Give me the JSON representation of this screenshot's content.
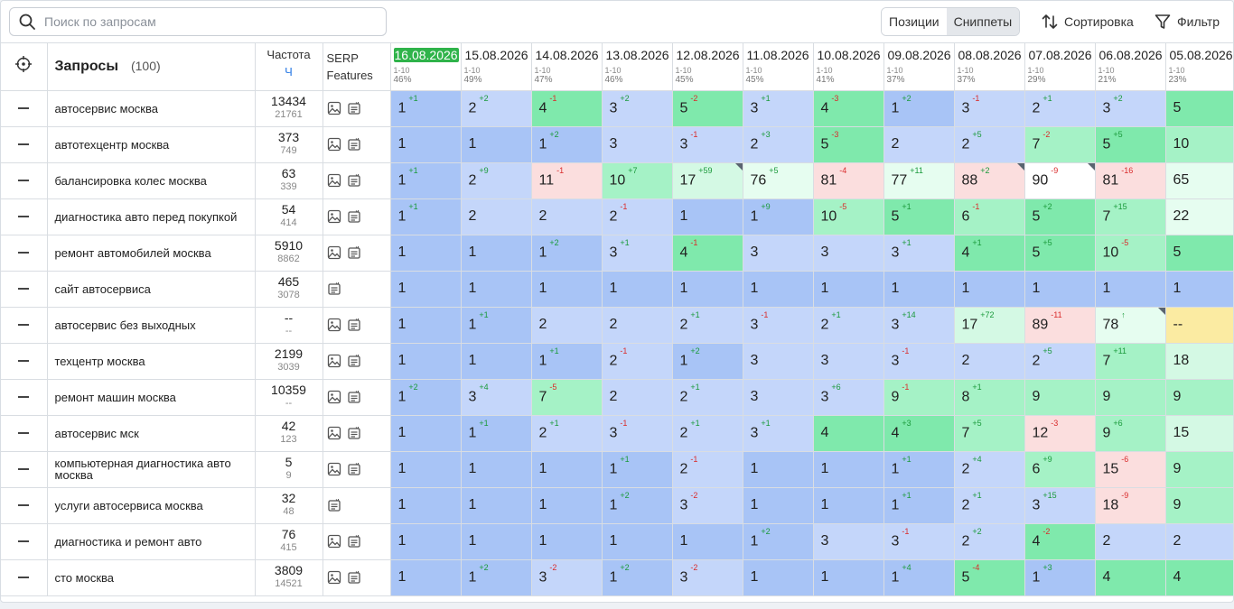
{
  "search": {
    "placeholder": "Поиск по запросам"
  },
  "toolbar": {
    "positions_label": "Позиции",
    "snippets_label": "Сниппеты",
    "sort_label": "Сортировка",
    "filter_label": "Фильтр"
  },
  "header": {
    "queries_label": "Запросы",
    "queries_count": "(100)",
    "freq_label": "Частота",
    "freq_unit": "Ч",
    "serp_label": "SERP\nFeatures"
  },
  "dates": [
    {
      "date": "16.08.2026",
      "range": "1-10",
      "pct": "46%",
      "current": true
    },
    {
      "date": "15.08.2026",
      "range": "1-10",
      "pct": "49%"
    },
    {
      "date": "14.08.2026",
      "range": "1-10",
      "pct": "47%"
    },
    {
      "date": "13.08.2026",
      "range": "1-10",
      "pct": "46%"
    },
    {
      "date": "12.08.2026",
      "range": "1-10",
      "pct": "45%"
    },
    {
      "date": "11.08.2026",
      "range": "1-10",
      "pct": "45%"
    },
    {
      "date": "10.08.2026",
      "range": "1-10",
      "pct": "41%"
    },
    {
      "date": "09.08.2026",
      "range": "1-10",
      "pct": "37%"
    },
    {
      "date": "08.08.2026",
      "range": "1-10",
      "pct": "37%"
    },
    {
      "date": "07.08.2026",
      "range": "1-10",
      "pct": "29%"
    },
    {
      "date": "06.08.2026",
      "range": "1-10",
      "pct": "21%"
    },
    {
      "date": "05.08.2026",
      "range": "1-10",
      "pct": "23%"
    }
  ],
  "rows": [
    {
      "query": "автосервис москва",
      "freq": "13434",
      "freq2": "21761",
      "serp": [
        "image",
        "snippet"
      ],
      "cells": [
        [
          "1",
          "+1"
        ],
        [
          "2",
          "+2"
        ],
        [
          "4",
          "-1"
        ],
        [
          "3",
          "+2"
        ],
        [
          "5",
          "-2"
        ],
        [
          "3",
          "+1"
        ],
        [
          "4",
          "-3"
        ],
        [
          "1",
          "+2"
        ],
        [
          "3",
          "-1"
        ],
        [
          "2",
          "+1"
        ],
        [
          "3",
          "+2"
        ],
        [
          "5",
          ""
        ]
      ]
    },
    {
      "query": "автотехцентр москва",
      "freq": "373",
      "freq2": "749",
      "serp": [
        "image",
        "snippet"
      ],
      "cells": [
        [
          "1",
          ""
        ],
        [
          "1",
          ""
        ],
        [
          "1",
          "+2"
        ],
        [
          "3",
          ""
        ],
        [
          "3",
          "-1"
        ],
        [
          "2",
          "+3"
        ],
        [
          "5",
          "-3"
        ],
        [
          "2",
          ""
        ],
        [
          "2",
          "+5"
        ],
        [
          "7",
          "-2"
        ],
        [
          "5",
          "+5"
        ],
        [
          "10",
          ""
        ]
      ]
    },
    {
      "query": "балансировка колес москва",
      "freq": "63",
      "freq2": "339",
      "serp": [
        "image",
        "snippet"
      ],
      "cells": [
        [
          "1",
          "+1"
        ],
        [
          "2",
          "+9"
        ],
        [
          "11",
          "-1"
        ],
        [
          "10",
          "+7"
        ],
        [
          "17",
          "+59"
        ],
        [
          "76",
          "+5"
        ],
        [
          "81",
          "-4"
        ],
        [
          "77",
          "+11"
        ],
        [
          "88",
          "+2"
        ],
        [
          "90",
          "-9"
        ],
        [
          "81",
          "-16"
        ],
        [
          "65",
          ""
        ]
      ],
      "marks": [
        4,
        8,
        9
      ]
    },
    {
      "query": "диагностика авто перед покупкой",
      "freq": "54",
      "freq2": "414",
      "serp": [
        "image",
        "snippet"
      ],
      "cells": [
        [
          "1",
          "+1"
        ],
        [
          "2",
          ""
        ],
        [
          "2",
          ""
        ],
        [
          "2",
          "-1"
        ],
        [
          "1",
          ""
        ],
        [
          "1",
          "+9"
        ],
        [
          "10",
          "-5"
        ],
        [
          "5",
          "+1"
        ],
        [
          "6",
          "-1"
        ],
        [
          "5",
          "+2"
        ],
        [
          "7",
          "+15"
        ],
        [
          "22",
          ""
        ]
      ]
    },
    {
      "query": "ремонт автомобилей москва",
      "freq": "5910",
      "freq2": "8862",
      "serp": [
        "image",
        "snippet"
      ],
      "cells": [
        [
          "1",
          ""
        ],
        [
          "1",
          ""
        ],
        [
          "1",
          "+2"
        ],
        [
          "3",
          "+1"
        ],
        [
          "4",
          "-1"
        ],
        [
          "3",
          ""
        ],
        [
          "3",
          ""
        ],
        [
          "3",
          "+1"
        ],
        [
          "4",
          "+1"
        ],
        [
          "5",
          "+5"
        ],
        [
          "10",
          "-5"
        ],
        [
          "5",
          ""
        ]
      ]
    },
    {
      "query": "сайт автосервиса",
      "freq": "465",
      "freq2": "3078",
      "serp": [
        "snippet"
      ],
      "cells": [
        [
          "1",
          ""
        ],
        [
          "1",
          ""
        ],
        [
          "1",
          ""
        ],
        [
          "1",
          ""
        ],
        [
          "1",
          ""
        ],
        [
          "1",
          ""
        ],
        [
          "1",
          ""
        ],
        [
          "1",
          ""
        ],
        [
          "1",
          ""
        ],
        [
          "1",
          ""
        ],
        [
          "1",
          ""
        ],
        [
          "1",
          ""
        ]
      ]
    },
    {
      "query": "автосервис без выходных",
      "freq": "--",
      "freq2": "--",
      "serp": [
        "image",
        "snippet"
      ],
      "cells": [
        [
          "1",
          ""
        ],
        [
          "1",
          "+1"
        ],
        [
          "2",
          ""
        ],
        [
          "2",
          ""
        ],
        [
          "2",
          "+1"
        ],
        [
          "3",
          "-1"
        ],
        [
          "2",
          "+1"
        ],
        [
          "3",
          "+14"
        ],
        [
          "17",
          "+72"
        ],
        [
          "89",
          "-11"
        ],
        [
          "78",
          "↑"
        ],
        [
          "--",
          ""
        ]
      ],
      "marks": [
        10
      ]
    },
    {
      "query": "техцентр москва",
      "freq": "2199",
      "freq2": "3039",
      "serp": [
        "image",
        "snippet"
      ],
      "cells": [
        [
          "1",
          ""
        ],
        [
          "1",
          ""
        ],
        [
          "1",
          "+1"
        ],
        [
          "2",
          "-1"
        ],
        [
          "1",
          "+2"
        ],
        [
          "3",
          ""
        ],
        [
          "3",
          ""
        ],
        [
          "3",
          "-1"
        ],
        [
          "2",
          ""
        ],
        [
          "2",
          "+5"
        ],
        [
          "7",
          "+11"
        ],
        [
          "18",
          ""
        ]
      ]
    },
    {
      "query": "ремонт машин москва",
      "freq": "10359",
      "freq2": "--",
      "serp": [
        "image",
        "snippet"
      ],
      "cells": [
        [
          "1",
          "+2"
        ],
        [
          "3",
          "+4"
        ],
        [
          "7",
          "-5"
        ],
        [
          "2",
          ""
        ],
        [
          "2",
          "+1"
        ],
        [
          "3",
          ""
        ],
        [
          "3",
          "+6"
        ],
        [
          "9",
          "-1"
        ],
        [
          "8",
          "+1"
        ],
        [
          "9",
          ""
        ],
        [
          "9",
          ""
        ],
        [
          "9",
          ""
        ]
      ]
    },
    {
      "query": "автосервис мск",
      "freq": "42",
      "freq2": "123",
      "serp": [
        "image",
        "snippet"
      ],
      "cells": [
        [
          "1",
          ""
        ],
        [
          "1",
          "+1"
        ],
        [
          "2",
          "+1"
        ],
        [
          "3",
          "-1"
        ],
        [
          "2",
          "+1"
        ],
        [
          "3",
          "+1"
        ],
        [
          "4",
          ""
        ],
        [
          "4",
          "+3"
        ],
        [
          "7",
          "+5"
        ],
        [
          "12",
          "-3"
        ],
        [
          "9",
          "+6"
        ],
        [
          "15",
          ""
        ]
      ]
    },
    {
      "query": "компьютерная диагностика авто москва",
      "freq": "5",
      "freq2": "9",
      "serp": [
        "image",
        "snippet"
      ],
      "cells": [
        [
          "1",
          ""
        ],
        [
          "1",
          ""
        ],
        [
          "1",
          ""
        ],
        [
          "1",
          "+1"
        ],
        [
          "2",
          "-1"
        ],
        [
          "1",
          ""
        ],
        [
          "1",
          ""
        ],
        [
          "1",
          "+1"
        ],
        [
          "2",
          "+4"
        ],
        [
          "6",
          "+9"
        ],
        [
          "15",
          "-6"
        ],
        [
          "9",
          ""
        ]
      ]
    },
    {
      "query": "услуги автосервиса москва",
      "freq": "32",
      "freq2": "48",
      "serp": [
        "snippet"
      ],
      "cells": [
        [
          "1",
          ""
        ],
        [
          "1",
          ""
        ],
        [
          "1",
          ""
        ],
        [
          "1",
          "+2"
        ],
        [
          "3",
          "-2"
        ],
        [
          "1",
          ""
        ],
        [
          "1",
          ""
        ],
        [
          "1",
          "+1"
        ],
        [
          "2",
          "+1"
        ],
        [
          "3",
          "+15"
        ],
        [
          "18",
          "-9"
        ],
        [
          "9",
          ""
        ]
      ]
    },
    {
      "query": "диагностика и ремонт авто",
      "freq": "76",
      "freq2": "415",
      "serp": [
        "image",
        "snippet"
      ],
      "cells": [
        [
          "1",
          ""
        ],
        [
          "1",
          ""
        ],
        [
          "1",
          ""
        ],
        [
          "1",
          ""
        ],
        [
          "1",
          ""
        ],
        [
          "1",
          "+2"
        ],
        [
          "3",
          ""
        ],
        [
          "3",
          "-1"
        ],
        [
          "2",
          "+2"
        ],
        [
          "4",
          "-2"
        ],
        [
          "2",
          ""
        ],
        [
          "2",
          ""
        ]
      ]
    },
    {
      "query": "сто москва",
      "freq": "3809",
      "freq2": "14521",
      "serp": [
        "image",
        "snippet"
      ],
      "cells": [
        [
          "1",
          ""
        ],
        [
          "1",
          "+2"
        ],
        [
          "3",
          "-2"
        ],
        [
          "1",
          "+2"
        ],
        [
          "3",
          "-2"
        ],
        [
          "1",
          ""
        ],
        [
          "1",
          ""
        ],
        [
          "1",
          "+4"
        ],
        [
          "5",
          "-4"
        ],
        [
          "1",
          "+3"
        ],
        [
          "4",
          ""
        ],
        [
          "4",
          ""
        ]
      ]
    }
  ],
  "colors": {
    "accent_date": "#2fb34a",
    "top1": "#a8c4f6",
    "top3": "#c4d6fa",
    "top5": "#7fe9ac",
    "top10": "#a5f2c6",
    "top20": "#d4f9e4",
    "down": "#fbdede",
    "up_text": "#1a9a3b",
    "down_text": "#d92b2b"
  }
}
